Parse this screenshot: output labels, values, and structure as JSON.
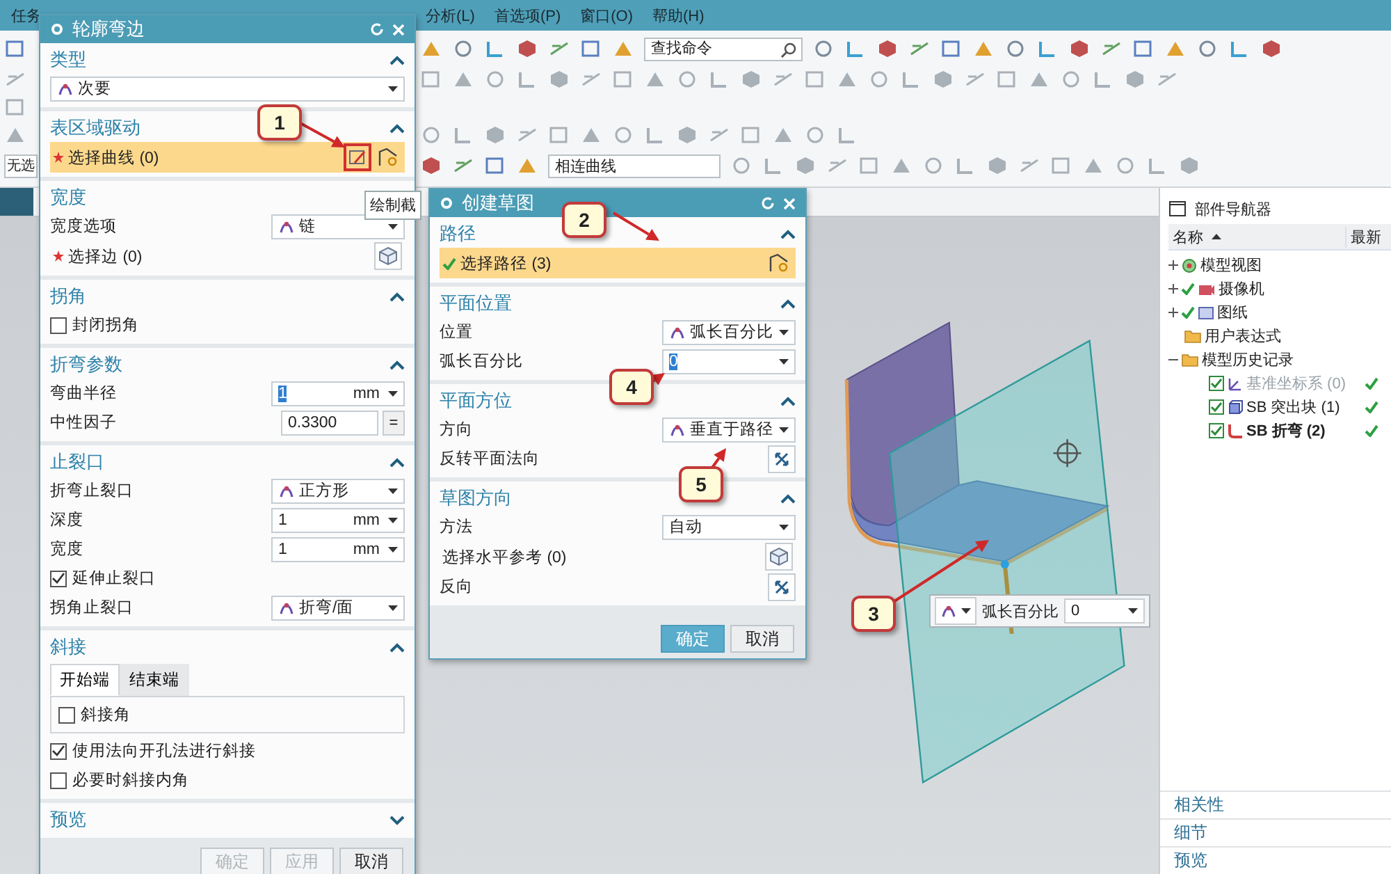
{
  "menu_bar": [
    {
      "label": "任务"
    },
    {
      "label": "分析(L)"
    },
    {
      "label": "首选项(P)"
    },
    {
      "label": "窗口(O)"
    },
    {
      "label": "帮助(H)"
    }
  ],
  "toolbar": {
    "search": {
      "placeholder": "查找命令"
    },
    "selection_filter": {
      "value": "无选"
    },
    "curve_rule": {
      "value": "相连曲线"
    }
  },
  "tooltip": "绘制截",
  "dialogs": [
    {
      "title": "轮廓弯边",
      "sections": [
        {
          "title": "类型",
          "expanded": true,
          "rows": [
            {
              "kind": "dropdown",
              "value": "次要",
              "icon": true
            }
          ]
        },
        {
          "title": "表区域驱动",
          "expanded": true,
          "rows": [
            {
              "kind": "select",
              "label": "选择曲线 (0)",
              "required": true,
              "done": false,
              "highlighted": true,
              "tools": [
                {
                  "kind": "sketch",
                  "selected": true
                },
                {
                  "kind": "curve",
                  "selected": false
                }
              ]
            }
          ]
        },
        {
          "title": "宽度",
          "expanded": true,
          "rows": [
            {
              "kind": "dropdown",
              "label": "宽度选项",
              "value": "链",
              "icon": true
            },
            {
              "kind": "select",
              "label": "选择边 (0)",
              "required": true,
              "done": false,
              "highlighted": false,
              "tools": [
                {
                  "kind": "cube",
                  "selected": false
                }
              ]
            }
          ]
        },
        {
          "title": "拐角",
          "expanded": true,
          "rows": [
            {
              "kind": "checkbox",
              "label": "封闭拐角",
              "checked": false
            }
          ]
        },
        {
          "title": "折弯参数",
          "expanded": true,
          "rows": [
            {
              "kind": "field",
              "label": "弯曲半径",
              "value": "1",
              "unit": "mm",
              "selected": true
            },
            {
              "kind": "field",
              "label": "中性因子",
              "value": "0.3300",
              "button": "=",
              "selected": false
            }
          ]
        },
        {
          "title": "止裂口",
          "expanded": true,
          "rows": [
            {
              "kind": "dropdown",
              "label": "折弯止裂口",
              "value": "正方形",
              "icon": true
            },
            {
              "kind": "field",
              "label": "深度",
              "value": "1",
              "unit": "mm",
              "selected": false
            },
            {
              "kind": "field",
              "label": "宽度",
              "value": "1",
              "unit": "mm",
              "selected": false
            },
            {
              "kind": "checkbox",
              "label": "延伸止裂口",
              "checked": true
            },
            {
              "kind": "dropdown",
              "label": "拐角止裂口",
              "value": "折弯/面",
              "icon": true
            }
          ]
        },
        {
          "title": "斜接",
          "expanded": true,
          "rows": [
            {
              "kind": "tabs",
              "tabs": [
                {
                  "label": "开始端",
                  "selected": true
                },
                {
                  "label": "结束端",
                  "selected": false
                }
              ],
              "rows": [
                {
                  "kind": "checkbox",
                  "label": "斜接角",
                  "checked": false
                }
              ]
            },
            {
              "kind": "checkbox",
              "label": "使用法向开孔法进行斜接",
              "checked": true
            },
            {
              "kind": "checkbox",
              "label": "必要时斜接内角",
              "checked": false
            }
          ]
        },
        {
          "title": "预览",
          "expanded": false
        }
      ],
      "buttons": [
        {
          "label": "确定",
          "primary": false,
          "disabled": true
        },
        {
          "label": "应用",
          "primary": false,
          "disabled": true
        },
        {
          "label": "取消",
          "primary": false,
          "disabled": false
        }
      ]
    },
    {
      "title": "创建草图",
      "sections": [
        {
          "title": "路径",
          "expanded": true,
          "rows": [
            {
              "kind": "select",
              "label": "选择路径 (3)",
              "required": false,
              "done": true,
              "highlighted": true,
              "tools": [
                {
                  "kind": "curve",
                  "selected": false
                }
              ]
            }
          ]
        },
        {
          "title": "平面位置",
          "expanded": true,
          "rows": [
            {
              "kind": "dropdown",
              "label": "位置",
              "value": "弧长百分比",
              "icon": true
            },
            {
              "kind": "field",
              "label": "弧长百分比",
              "value": "0",
              "selected": true
            }
          ]
        },
        {
          "title": "平面方位",
          "expanded": true,
          "rows": [
            {
              "kind": "dropdown",
              "label": "方向",
              "value": "垂直于路径",
              "icon": true
            },
            {
              "kind": "action",
              "label": "反转平面法向"
            }
          ]
        },
        {
          "title": "草图方向",
          "expanded": true,
          "rows": [
            {
              "kind": "dropdown",
              "label": "方法",
              "value": "自动",
              "icon": false
            },
            {
              "kind": "select",
              "label": "选择水平参考 (0)",
              "required": false,
              "done": false,
              "highlighted": false,
              "tools": [
                {
                  "kind": "cube",
                  "selected": false
                }
              ]
            },
            {
              "kind": "action",
              "label": "反向"
            }
          ]
        }
      ],
      "buttons": [
        {
          "label": "确定",
          "primary": true,
          "disabled": false
        },
        {
          "label": "取消",
          "primary": false,
          "disabled": false
        }
      ]
    }
  ],
  "floating_bar": {
    "label": "弧长百分比",
    "value": "0"
  },
  "part_navigator": {
    "title": "部件导航器",
    "columns": [
      {
        "label": "名称",
        "sorted": true
      },
      {
        "label": "最新",
        "sorted": false
      }
    ],
    "tree": [
      {
        "label": "模型视图",
        "kind": "views",
        "expanded": false,
        "visible": false
      },
      {
        "label": "摄像机",
        "kind": "camera",
        "expanded": false,
        "visible": true
      },
      {
        "label": "图纸",
        "kind": "drawing",
        "expanded": false,
        "visible": true
      },
      {
        "label": "用户表达式",
        "kind": "folder",
        "visible": false
      },
      {
        "label": "模型历史记录",
        "kind": "folder",
        "expanded": true,
        "visible": false,
        "children": [
          {
            "label": "基准坐标系 (0)",
            "kind": "datum",
            "checked": true,
            "disabled": true,
            "current": false,
            "latest": true
          },
          {
            "label": "SB 突出块 (1)",
            "kind": "block",
            "checked": true,
            "disabled": false,
            "current": false,
            "latest": true
          },
          {
            "label": "SB 折弯 (2)",
            "kind": "bend",
            "checked": true,
            "disabled": false,
            "current": true,
            "latest": true
          }
        ]
      }
    ],
    "panels": [
      {
        "title": "相关性"
      },
      {
        "title": "细节"
      },
      {
        "title": "预览"
      }
    ]
  },
  "callouts": [
    {
      "number": "1"
    },
    {
      "number": "2"
    },
    {
      "number": "3"
    },
    {
      "number": "4"
    },
    {
      "number": "5"
    }
  ]
}
